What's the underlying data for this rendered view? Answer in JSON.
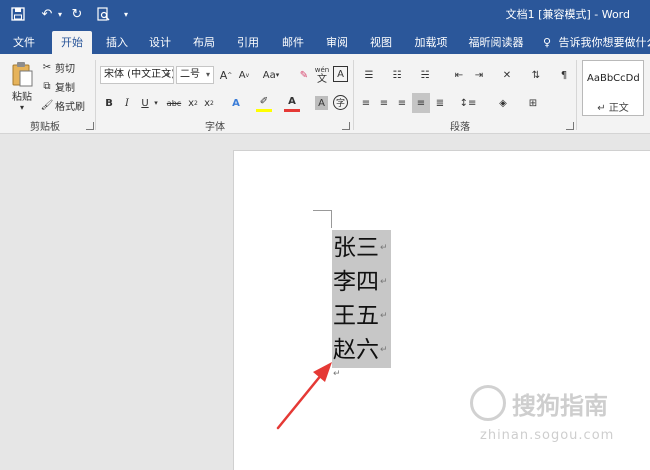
{
  "window": {
    "title": "文档1 [兼容模式] - Word"
  },
  "tabs": [
    {
      "label": "文件"
    },
    {
      "label": "开始"
    },
    {
      "label": "插入"
    },
    {
      "label": "设计"
    },
    {
      "label": "布局"
    },
    {
      "label": "引用"
    },
    {
      "label": "邮件"
    },
    {
      "label": "审阅"
    },
    {
      "label": "视图"
    },
    {
      "label": "加载项"
    },
    {
      "label": "福昕阅读器"
    }
  ],
  "tell_me": "告诉我你想要做什么",
  "clipboard": {
    "paste": "粘贴",
    "cut": "剪切",
    "copy": "复制",
    "format_painter": "格式刷",
    "label": "剪贴板"
  },
  "font": {
    "name": "宋体 (中文正文)",
    "size": "二号",
    "aa": "Aa",
    "label": "字体",
    "wen": "wén",
    "wen_char": "文"
  },
  "paragraph": {
    "label": "段落"
  },
  "styles": {
    "preview": "AaBbCcDd",
    "name": "↵ 正文"
  },
  "document": {
    "lines": [
      "张三",
      "李四",
      "王五",
      "赵六"
    ],
    "pilcrow": "↵"
  },
  "watermark": {
    "name": "搜狗指南",
    "url": "zhinan.sogou.com"
  },
  "colors": {
    "accent": "#2b579a",
    "arrow": "#e53935"
  }
}
